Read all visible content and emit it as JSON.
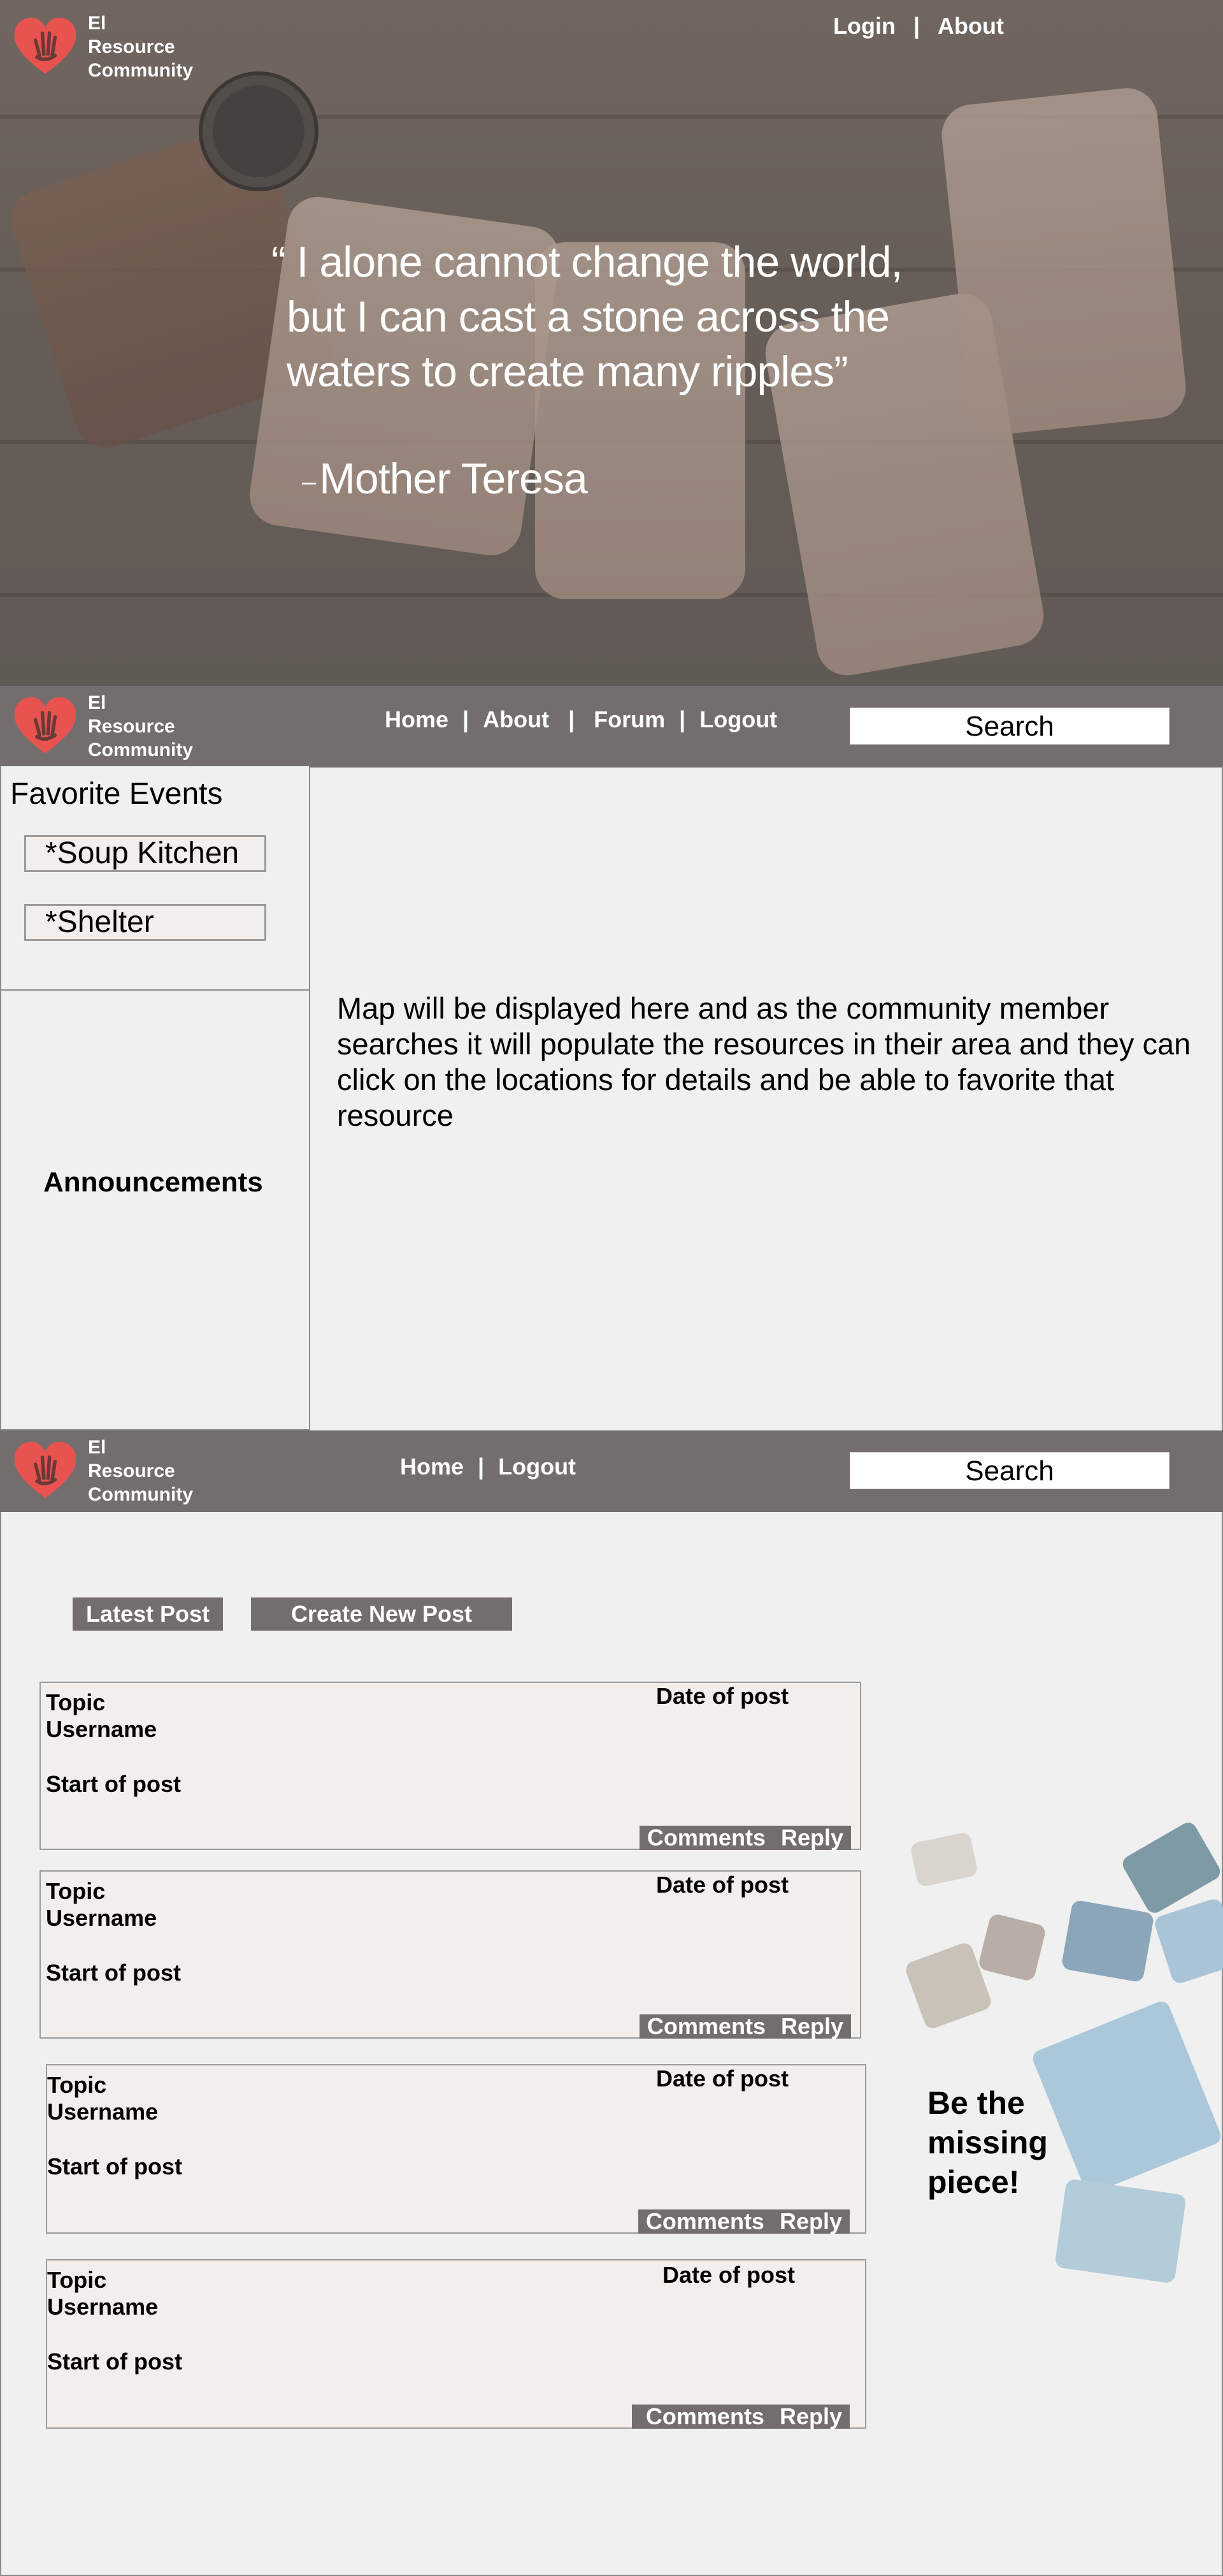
{
  "colors": {
    "bar": "#736e6d",
    "panel": "#f2eeeb",
    "heart": "#e8534f"
  },
  "brand": {
    "name_line1": "El",
    "name_line2": "Resource",
    "name_line3": "Community",
    "icon": "heart-hand-icon"
  },
  "hero": {
    "nav": {
      "login": "Login",
      "separator": "|",
      "about": "About"
    },
    "quote_line1": "“ I alone cannot change the world,",
    "quote_line2": "but I can cast a stone across the",
    "quote_line3": "waters to create many ripples”",
    "author_dash": "–",
    "author": "Mother Teresa"
  },
  "dashboard": {
    "nav": {
      "home": "Home",
      "about": "About",
      "forum": "Forum",
      "logout": "Logout",
      "separator": "|"
    },
    "search": "Search",
    "favorites_title": "Favorite Events",
    "favorites": [
      "*Soup Kitchen",
      "*Shelter"
    ],
    "announcements": "Announcements",
    "map_note": "Map will be displayed here and as the community member searches it will populate the resources in their area and they can click on the locations for details and be able to favorite that resource"
  },
  "forum": {
    "nav": {
      "home": "Home",
      "logout": "Logout",
      "separator": "|"
    },
    "search": "Search",
    "latest_post": "Latest Post",
    "create_post": "Create New Post",
    "posts": [
      {
        "topic": "Topic",
        "username": "Username",
        "start": "Start of post",
        "date": "Date of post",
        "comments": "Comments",
        "reply": "Reply"
      },
      {
        "topic": "Topic",
        "username": "Username",
        "start": "Start of post",
        "date": "Date of post",
        "comments": "Comments",
        "reply": "Reply"
      },
      {
        "topic": "Topic",
        "username": "Username",
        "start": "Start of post",
        "date": "Date of post",
        "comments": "Comments",
        "reply": "Reply"
      },
      {
        "topic": "Topic",
        "username": "Username",
        "start": "Start of post",
        "date": "Date of post",
        "comments": "Comments",
        "reply": "Reply"
      }
    ],
    "tagline_line1": "Be the",
    "tagline_line2": "missing",
    "tagline_line3": "piece!"
  }
}
